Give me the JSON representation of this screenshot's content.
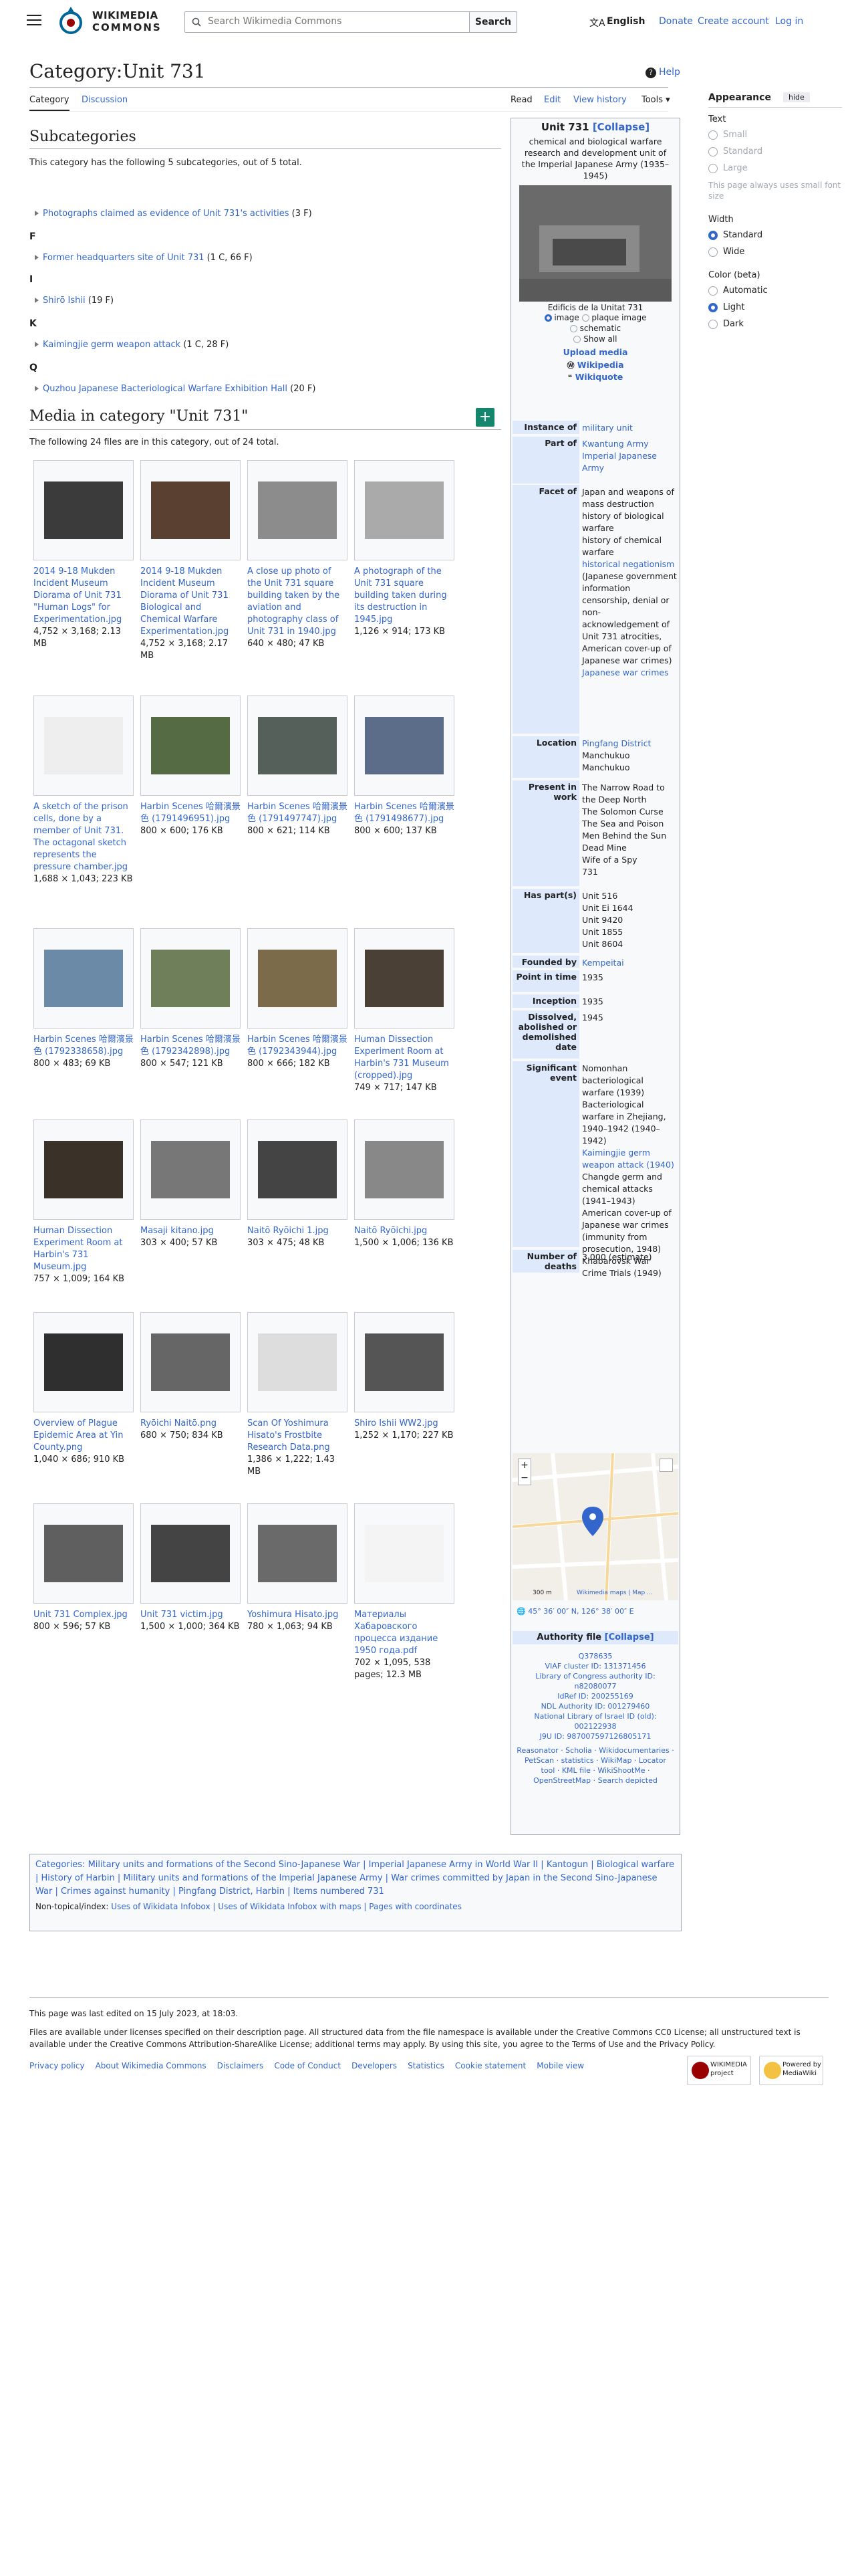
{
  "header": {
    "logo_line1": "WIKIMEDIA",
    "logo_line2": "COMMONS",
    "search_placeholder": "Search Wikimedia Commons",
    "search_button": "Search",
    "language": "English",
    "donate": "Donate",
    "create_account": "Create account",
    "login": "Log in"
  },
  "page": {
    "title": "Category:Unit 731",
    "help": "Help",
    "tabs": {
      "category": "Category",
      "discussion": "Discussion",
      "read": "Read",
      "edit": "Edit",
      "history": "View history",
      "tools": "Tools"
    }
  },
  "appearance": {
    "title": "Appearance",
    "hide": "hide",
    "text_label": "Text",
    "text_opts": [
      "Small",
      "Standard",
      "Large"
    ],
    "text_note": "This page always uses small font size",
    "width_label": "Width",
    "width_opts": [
      "Standard",
      "Wide"
    ],
    "color_label": "Color (beta)",
    "color_opts": [
      "Automatic",
      "Light",
      "Dark"
    ]
  },
  "subcats": {
    "heading": "Subcategories",
    "intro": "This category has the following 5 subcategories, out of 5 total.",
    "items": [
      {
        "letter": "",
        "label": "Photographs claimed as evidence of Unit 731's activities",
        "count": "(3 F)"
      },
      {
        "letter": "F",
        "label": "Former headquarters site of Unit 731",
        "count": "(1 C, 66 F)"
      },
      {
        "letter": "I",
        "label": "Shirō Ishii",
        "count": "(19 F)"
      },
      {
        "letter": "K",
        "label": "Kaimingjie germ weapon attack",
        "count": "(1 C, 28 F)"
      },
      {
        "letter": "Q",
        "label": "Quzhou Japanese Bacteriological Warfare Exhibition Hall",
        "count": "(20 F)"
      }
    ]
  },
  "media": {
    "heading": "Media in category \"Unit 731\"",
    "intro": "The following 24 files are in this category, out of 24 total.",
    "files": [
      {
        "name": "2014 9-18 Mukden Incident Museum Diorama of Unit 731 \"Human Logs\" for Experimentation.jpg",
        "meta": "4,752 × 3,168; 2.13 MB"
      },
      {
        "name": "2014 9-18 Mukden Incident Museum Diorama of Unit 731 Biological and Chemical Warfare Experimentation.jpg",
        "meta": "4,752 × 3,168; 2.17 MB"
      },
      {
        "name": "A close up photo of the Unit 731 square building taken by the aviation and photography class of Unit 731 in 1940.jpg",
        "meta": "640 × 480; 47 KB"
      },
      {
        "name": "A photograph of the Unit 731 square building taken during its destruction in 1945.jpg",
        "meta": "1,126 × 914; 173 KB"
      },
      {
        "name": "A sketch of the prison cells, done by a member of Unit 731. The octagonal sketch represents the pressure chamber.jpg",
        "meta": "1,688 × 1,043; 223 KB"
      },
      {
        "name": "Harbin Scenes 哈爾濱景色 (1791496951).jpg",
        "meta": "800 × 600; 176 KB"
      },
      {
        "name": "Harbin Scenes 哈爾濱景色 (1791497747).jpg",
        "meta": "800 × 621; 114 KB"
      },
      {
        "name": "Harbin Scenes 哈爾濱景色 (1791498677).jpg",
        "meta": "800 × 600; 137 KB"
      },
      {
        "name": "Harbin Scenes 哈爾濱景色 (1792338658).jpg",
        "meta": "800 × 483; 69 KB"
      },
      {
        "name": "Harbin Scenes 哈爾濱景色 (1792342898).jpg",
        "meta": "800 × 547; 121 KB"
      },
      {
        "name": "Harbin Scenes 哈爾濱景色 (1792343944).jpg",
        "meta": "800 × 666; 182 KB"
      },
      {
        "name": "Human Dissection Experiment Room at Harbin's 731 Museum (cropped).jpg",
        "meta": "749 × 717; 147 KB"
      },
      {
        "name": "Human Dissection Experiment Room at Harbin's 731 Museum.jpg",
        "meta": "757 × 1,009; 164 KB"
      },
      {
        "name": "Masaji kitano.jpg",
        "meta": "303 × 400; 57 KB"
      },
      {
        "name": "Naitō Ryōichi 1.jpg",
        "meta": "303 × 475; 48 KB"
      },
      {
        "name": "Naitō Ryōichi.jpg",
        "meta": "1,500 × 1,006; 136 KB"
      },
      {
        "name": "Overview of Plague Epidemic Area at Yin County.png",
        "meta": "1,040 × 686; 910 KB"
      },
      {
        "name": "Ryōichi Naitō.png",
        "meta": "680 × 750; 834 KB"
      },
      {
        "name": "Scan Of Yoshimura Hisato's Frostbite Research Data.png",
        "meta": "1,386 × 1,222; 1.43 MB"
      },
      {
        "name": "Shiro Ishii WW2.jpg",
        "meta": "1,252 × 1,170; 227 KB"
      },
      {
        "name": "Unit 731 Complex.jpg",
        "meta": "800 × 596; 57 KB"
      },
      {
        "name": "Unit 731 victim.jpg",
        "meta": "1,500 × 1,000; 364 KB"
      },
      {
        "name": "Yoshimura Hisato.jpg",
        "meta": "780 × 1,063; 94 KB"
      },
      {
        "name": "Материалы Хабаровского процесса издание 1950 года.pdf",
        "meta": "702 × 1,095, 538 pages; 12.3 MB"
      }
    ]
  },
  "infobox": {
    "title": "Unit 731",
    "collapse": "[Collapse]",
    "description": "chemical and biological warfare research and development unit of the Imperial Japanese Army (1935–1945)",
    "photo_caption": "Edificis de la Unitat 731",
    "view_opts": [
      "image",
      "plaque image",
      "schematic",
      "Show all"
    ],
    "upload": "Upload media",
    "wikipedia": "Wikipedia",
    "wikiquote": "Wikiquote",
    "rows": [
      {
        "label": "Instance of",
        "values": [
          "military unit"
        ]
      },
      {
        "label": "Part of",
        "values": [
          "Kwantung Army",
          "Imperial Japanese Army"
        ]
      },
      {
        "label": "Facet of",
        "values": [
          "Japan and weapons of mass destruction",
          "history of biological warfare",
          "history of chemical warfare",
          "historical negationism",
          "(Japanese government information censorship, denial or non-acknowledgement of Unit 731 atrocities, American cover-up of Japanese war crimes)",
          "Japanese war crimes"
        ]
      },
      {
        "label": "Location",
        "values": [
          "Pingfang District",
          "Manchukuo",
          "Manchukuo"
        ]
      },
      {
        "label": "Present in work",
        "values": [
          "The Narrow Road to the Deep North",
          "The Solomon Curse",
          "The Sea and Poison",
          "Men Behind the Sun",
          "Dead Mine",
          "Wife of a Spy",
          "731"
        ]
      },
      {
        "label": "Has part(s)",
        "values": [
          "Unit 516",
          "Unit Ei 1644",
          "Unit 9420",
          "Unit 1855",
          "Unit 8604"
        ]
      },
      {
        "label": "Founded by",
        "values": [
          "Kempeitai"
        ]
      },
      {
        "label": "Point in time",
        "values": [
          "1935"
        ]
      },
      {
        "label": "Inception",
        "values": [
          "1935"
        ]
      },
      {
        "label": "Dissolved, abolished or demolished date",
        "values": [
          "1945"
        ]
      },
      {
        "label": "Significant event",
        "values": [
          "Nomonhan bacteriological warfare (1939)",
          "Bacteriological warfare in Zhejiang, 1940–1942 (1940–1942)",
          "Kaimingjie germ weapon attack (1940)",
          "Changde germ and chemical attacks (1941–1943)",
          "American cover-up of Japanese war crimes (immunity from prosecution, 1948)",
          "Khabarovsk War Crime Trials (1949)"
        ]
      },
      {
        "label": "Number of deaths",
        "values": [
          "3,000 (estimate)"
        ]
      }
    ],
    "map_scale": "300 m",
    "map_credit": "Wikimedia maps | Map ...",
    "coords": "45° 36′ 00″ N, 126° 38′ 00″ E",
    "authority_title": "Authority file",
    "authority_collapse": "[Collapse]",
    "authority": [
      "Q378635",
      "VIAF cluster ID: 131371456",
      "Library of Congress authority ID: n82080077",
      "IdRef ID: 200255169",
      "NDL Authority ID: 001279460",
      "National Library of Israel ID (old): 002122938",
      "J9U ID: 987007597126805171",
      "Reasonator · Scholia · Wikidocumentaries · PetScan · statistics · WikiMap · Locator tool · KML file · WikiShootMe · OpenStreetMap · Search depicted"
    ]
  },
  "categories": {
    "label": "Categories:",
    "list": "Military units and formations of the Second Sino-Japanese War | Imperial Japanese Army in World War II | Kantogun | Biological warfare | History of Harbin | Military units and formations of the Imperial Japanese Army | War crimes committed by Japan in the Second Sino-Japanese War | Crimes against humanity | Pingfang District, Harbin | Items numbered 731",
    "hidden_label": "Non-topical/index:",
    "hidden": "Uses of Wikidata Infobox | Uses of Wikidata Infobox with maps | Pages with coordinates"
  },
  "footer": {
    "edited": "This page was last edited on 15 July 2023, at 18:03.",
    "license": "Files are available under licenses specified on their description page. All structured data from the file namespace is available under the Creative Commons CC0 License; all unstructured text is available under the Creative Commons Attribution-ShareAlike License; additional terms may apply. By using this site, you agree to the Terms of Use and the Privacy Policy.",
    "links": [
      "Privacy policy",
      "About Wikimedia Commons",
      "Disclaimers",
      "Code of Conduct",
      "Developers",
      "Statistics",
      "Cookie statement",
      "Mobile view"
    ],
    "badge1": "WIKIMEDIA project",
    "badge2": "Powered by MediaWiki"
  }
}
